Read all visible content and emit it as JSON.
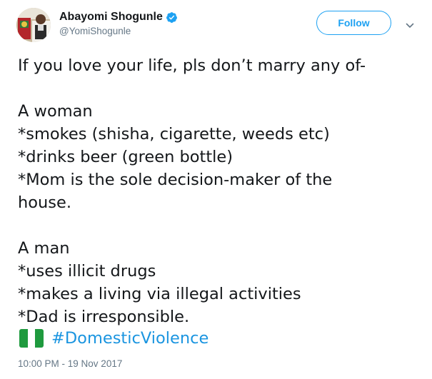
{
  "author": {
    "display_name": "Abayomi Shogunle",
    "handle": "@YomiShogunle",
    "verified": true
  },
  "actions": {
    "follow_label": "Follow",
    "more_icon": "chevron-down-icon"
  },
  "tweet": {
    "lines": [
      "If you love your life, pls don’t marry any of-",
      "",
      "A woman",
      "*smokes (shisha, cigarette, weeds etc)",
      "*drinks beer (green bottle)",
      "*Mom is the sole decision-maker of the",
      "house.",
      "",
      "A man",
      "*uses illicit drugs",
      "*makes a living via illegal activities",
      "*Dad is irresponsible."
    ],
    "flag_icon": "nigeria-flag-icon",
    "hashtag": "#DomesticViolence",
    "timestamp": "10:00 PM - 19 Nov 2017"
  },
  "colors": {
    "accent": "#1da1f2",
    "link": "#1b95e0",
    "text": "#14171a",
    "muted": "#657786"
  }
}
